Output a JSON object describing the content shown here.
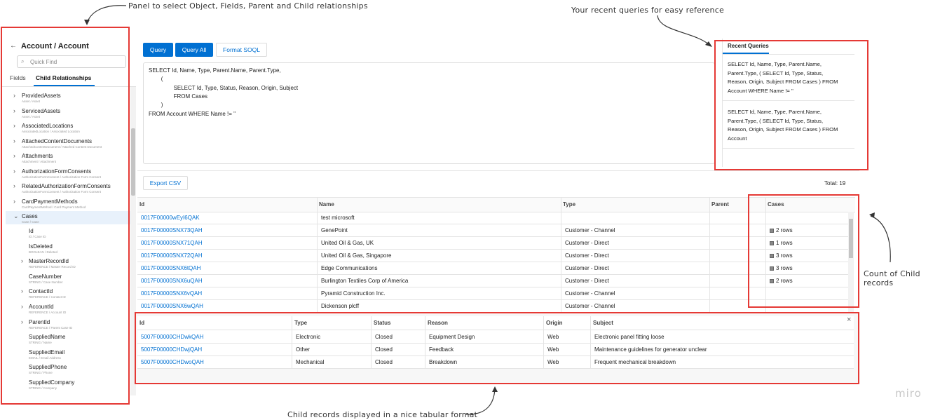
{
  "annotations": {
    "panel_note": "Panel to select Object, Fields, Parent and Child relationships",
    "recent_note": "Your recent queries for easy reference",
    "count_note": "Count of Child records",
    "child_note": "Child records displayed in a nice tabular format",
    "watermark": "miro"
  },
  "left_panel": {
    "title": "Account / Account",
    "search_placeholder": "Quick Find",
    "tabs": [
      "Fields",
      "Child Relationships"
    ],
    "items": [
      {
        "label": "ProvidedAssets",
        "sub": "Asset / Asset"
      },
      {
        "label": "ServicedAssets",
        "sub": "Asset / Asset"
      },
      {
        "label": "AssociatedLocations",
        "sub": "AssociatedLocation / Associated Location"
      },
      {
        "label": "AttachedContentDocuments",
        "sub": "AttachedContentDocument / Attached Content Document"
      },
      {
        "label": "Attachments",
        "sub": "Attachment / Attachment"
      },
      {
        "label": "AuthorizationFormConsents",
        "sub": "AuthorizationFormConsent / Authorization Form Consent"
      },
      {
        "label": "RelatedAuthorizationFormConsents",
        "sub": "AuthorizationFormConsent / Authorization Form Consent"
      },
      {
        "label": "CardPaymentMethods",
        "sub": "CardPaymentMethod / Card Payment Method"
      },
      {
        "label": "Cases",
        "sub": "Case / Case"
      }
    ],
    "case_fields": [
      {
        "label": "Id",
        "sub": "ID / Case ID"
      },
      {
        "label": "IsDeleted",
        "sub": "BOOLEAN / Deleted"
      },
      {
        "label": "MasterRecordId",
        "sub": "REFERENCE / Master Record ID"
      },
      {
        "label": "CaseNumber",
        "sub": "STRING / Case Number"
      },
      {
        "label": "ContactId",
        "sub": "REFERENCE / Contact ID"
      },
      {
        "label": "AccountId",
        "sub": "REFERENCE / Account ID"
      },
      {
        "label": "ParentId",
        "sub": "REFERENCE / Parent Case ID"
      },
      {
        "label": "SuppliedName",
        "sub": "STRING / Name"
      },
      {
        "label": "SuppliedEmail",
        "sub": "EMAIL / Email Address"
      },
      {
        "label": "SuppliedPhone",
        "sub": "STRING / Phone"
      },
      {
        "label": "SuppliedCompany",
        "sub": "STRING / Company"
      }
    ]
  },
  "toolbar": {
    "query": "Query",
    "query_all": "Query All",
    "format": "Format SOQL"
  },
  "editor": {
    "lines": [
      "SELECT Id, Name, Type, Parent.Name, Parent.Type,",
      "        (",
      "                SELECT Id, Type, Status, Reason, Origin, Subject",
      "                FROM Cases",
      "        )",
      "FROM Account WHERE Name != ''"
    ]
  },
  "recent": {
    "title": "Recent Queries",
    "queries": [
      [
        "SELECT Id, Name, Type, Parent.Name,",
        "Parent.Type, ( SELECT Id, Type, Status,",
        "Reason, Origin, Subject FROM Cases ) FROM",
        "Account WHERE Name != ''"
      ],
      [
        "SELECT Id, Name, Type, Parent.Name,",
        "Parent.Type, ( SELECT Id, Type, Status,",
        "Reason, Origin, Subject FROM Cases ) FROM",
        "Account"
      ]
    ]
  },
  "results": {
    "export": "Export CSV",
    "total": "Total: 19",
    "columns": [
      "Id",
      "Name",
      "Type",
      "Parent",
      "Cases"
    ],
    "rows": [
      {
        "id": "0017F00000wEyI6QAK",
        "name": "test microsoft",
        "type": "",
        "cases": ""
      },
      {
        "id": "0017F00000SNX73QAH",
        "name": "GenePoint",
        "type": "Customer - Channel",
        "cases": "2 rows"
      },
      {
        "id": "0017F00000SNX71QAH",
        "name": "United Oil & Gas, UK",
        "type": "Customer - Direct",
        "cases": "1 rows"
      },
      {
        "id": "0017F00000SNX72QAH",
        "name": "United Oil & Gas, Singapore",
        "type": "Customer - Direct",
        "cases": "3 rows"
      },
      {
        "id": "0017F00000SNX6tQAH",
        "name": "Edge Communications",
        "type": "Customer - Direct",
        "cases": "3 rows"
      },
      {
        "id": "0017F00000SNX6uQAH",
        "name": "Burlington Textiles Corp of America",
        "type": "Customer - Direct",
        "cases": "2 rows"
      },
      {
        "id": "0017F00000SNX6vQAH",
        "name": "Pyramid Construction Inc.",
        "type": "Customer - Channel",
        "cases": ""
      },
      {
        "id": "0017F00000SNX6wQAH",
        "name": "Dickenson plcff",
        "type": "Customer - Channel",
        "cases": ""
      }
    ]
  },
  "child": {
    "columns": [
      "Id",
      "Type",
      "Status",
      "Reason",
      "Origin",
      "Subject"
    ],
    "rows": [
      {
        "id": "5007F00000CHDwkQAH",
        "type": "Electronic",
        "status": "Closed",
        "reason": "Equipment Design",
        "origin": "Web",
        "subject": "Electronic panel fitting loose"
      },
      {
        "id": "5007F00000CHDwjQAH",
        "type": "Other",
        "status": "Closed",
        "reason": "Feedback",
        "origin": "Web",
        "subject": "Maintenance guidelines for generator unclear"
      },
      {
        "id": "5007F00000CHDwoQAH",
        "type": "Mechanical",
        "status": "Closed",
        "reason": "Breakdown",
        "origin": "Web",
        "subject": "Frequent mechanical breakdown"
      }
    ]
  }
}
